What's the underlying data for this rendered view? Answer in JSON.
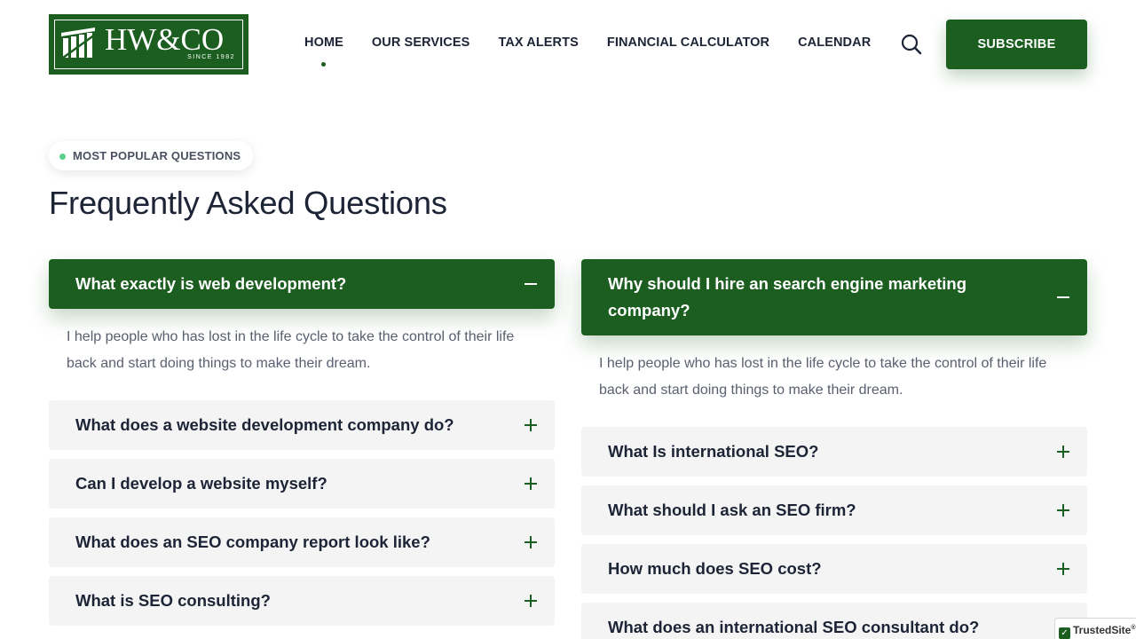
{
  "header": {
    "logo": {
      "text": "HW&CO",
      "since": "SINCE 1982"
    },
    "nav": [
      {
        "label": "HOME",
        "active": true
      },
      {
        "label": "OUR SERVICES",
        "active": false
      },
      {
        "label": "TAX ALERTS",
        "active": false
      },
      {
        "label": "FINANCIAL CALCULATOR",
        "active": false
      },
      {
        "label": "CALENDAR",
        "active": false
      }
    ],
    "search_icon": "search-icon",
    "subscribe_label": "SUBSCRIBE"
  },
  "section": {
    "badge": "MOST POPULAR QUESTIONS",
    "title": "Frequently Asked Questions"
  },
  "faq": {
    "left": [
      {
        "question": "What exactly is web development?",
        "open": true,
        "answer": "I help people who has lost in the life cycle to take the control of their life back and start doing things to make their dream."
      },
      {
        "question": "What does a website development company do?",
        "open": false
      },
      {
        "question": "Can I develop a website myself?",
        "open": false
      },
      {
        "question": "What does an SEO company report look like?",
        "open": false
      },
      {
        "question": "What is SEO consulting?",
        "open": false
      }
    ],
    "right": [
      {
        "question": "Why should I hire an search engine marketing company?",
        "open": true,
        "answer": "I help people who has lost in the life cycle to take the control of their life back and start doing things to make their dream."
      },
      {
        "question": "What Is international SEO?",
        "open": false
      },
      {
        "question": "What should I ask an SEO firm?",
        "open": false
      },
      {
        "question": "How much does SEO cost?",
        "open": false
      },
      {
        "question": "What does an international SEO consultant do?",
        "open": false
      }
    ]
  },
  "trusted_badge": {
    "text": "TrustedSite",
    "mark": "®"
  },
  "colors": {
    "brand_green": "#1b5e20",
    "badge_dot": "#5ccf8c",
    "heading": "#1c2436",
    "accordion_bg": "#f4f4f5"
  }
}
